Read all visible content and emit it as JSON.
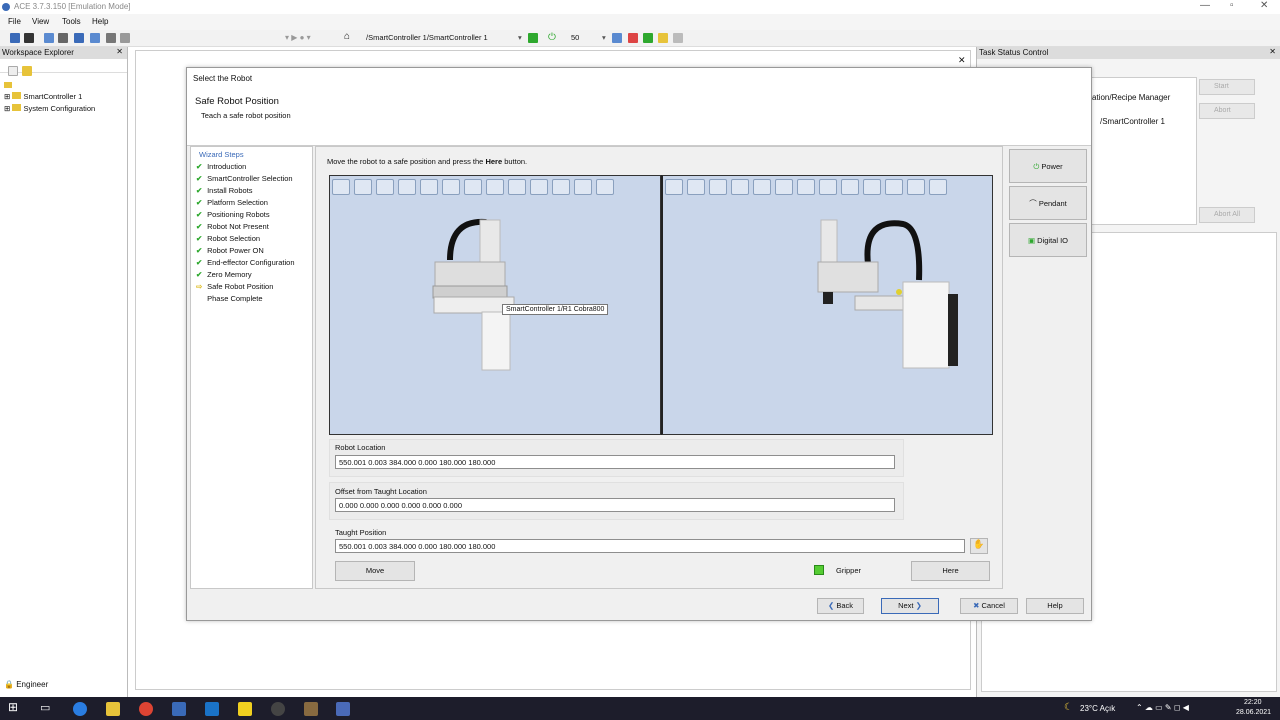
{
  "window": {
    "title": "ACE 3.7.3.150 [Emulation Mode]"
  },
  "menu": [
    "File",
    "View",
    "Tools",
    "Help"
  ],
  "toolbar": {
    "path": "/SmartController 1/SmartController 1",
    "speed": "50"
  },
  "workspace": {
    "title": "Workspace Explorer",
    "tree": [
      "SmartController 1",
      "System Configuration"
    ],
    "user": "Engineer"
  },
  "task_status": {
    "title": "Task Status Control",
    "rows": [
      "ation/Recipe Manager",
      "/SmartController 1"
    ],
    "buttons": [
      "Start",
      "Abort",
      "Abort All"
    ]
  },
  "dialog": {
    "window_title": "Select the Robot",
    "page_title": "Safe Robot Position",
    "page_subtitle": "Teach a safe robot position",
    "steps_header": "Wizard Steps",
    "steps": [
      {
        "label": "Introduction",
        "done": true
      },
      {
        "label": "SmartController Selection",
        "done": true
      },
      {
        "label": "Install Robots",
        "done": true
      },
      {
        "label": "Platform Selection",
        "done": true
      },
      {
        "label": "Positioning Robots",
        "done": true
      },
      {
        "label": "Robot Not Present",
        "done": true
      },
      {
        "label": "Robot Selection",
        "done": true
      },
      {
        "label": "Robot Power ON",
        "done": true
      },
      {
        "label": "End-effector Configuration",
        "done": true
      },
      {
        "label": "Zero Memory",
        "done": true
      },
      {
        "label": "Safe Robot Position",
        "done": false,
        "current": true
      },
      {
        "label": "Phase Complete",
        "done": false
      }
    ],
    "instruction_pre": "Move the robot to a safe position and press the ",
    "instruction_bold": "Here",
    "instruction_post": " button.",
    "tooltip": "SmartController 1/R1 Cobra800",
    "robot_location_label": "Robot Location",
    "robot_location": "550.001 0.003 384.000 0.000 180.000 180.000",
    "offset_label": "Offset from Taught Location",
    "offset": "0.000 0.000 0.000 0.000 0.000 0.000",
    "taught_label": "Taught Position",
    "taught": "550.001 0.003 384.000 0.000 180.000 180.000",
    "move_btn": "Move",
    "gripper": "Gripper",
    "here_btn": "Here",
    "side_buttons": [
      "Power",
      "Pendant",
      "Digital IO"
    ],
    "back": "Back",
    "next": "Next",
    "cancel": "Cancel",
    "help": "Help"
  },
  "taskbar": {
    "weather": "23°C Açık",
    "time": "22:20",
    "date": "28.06.2021"
  }
}
